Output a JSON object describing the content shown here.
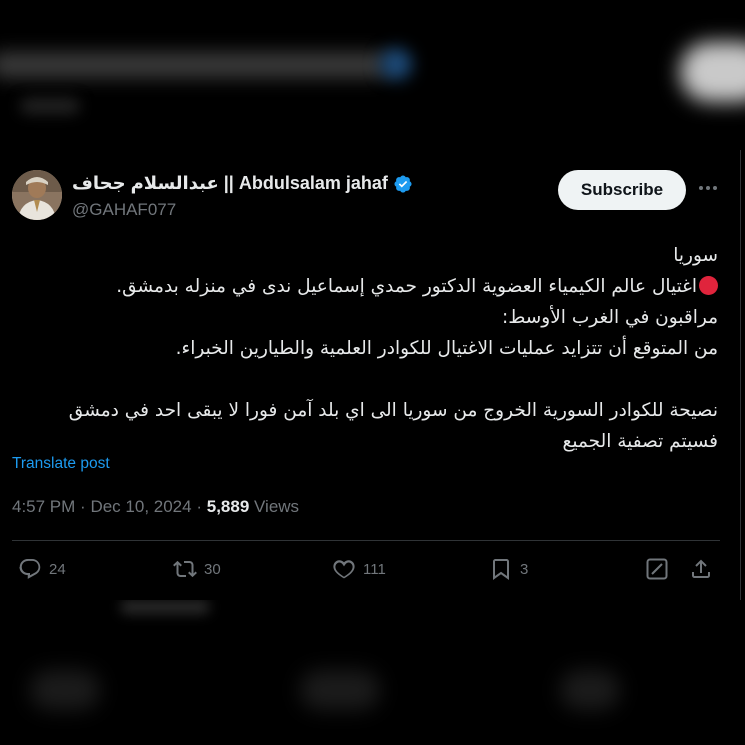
{
  "author": {
    "display_name": "عبدالسلام جحاف || Abdulsalam jahaf",
    "handle": "@GAHAF077",
    "verified": true
  },
  "subscribe_label": "Subscribe",
  "post": {
    "lines": [
      "سوريا",
      "اغتيال عالم الكيمياء العضوية الدكتور حمدي إسماعيل ندى في منزله بدمشق.",
      "مراقبون في الغرب الأوسط:",
      "من المتوقع أن تتزايد عمليات الاغتيال للكوادر العلمية والطيارين الخبراء.",
      "",
      "نصيحة للكوادر السورية الخروج من سوريا الى اي بلد آمن فورا لا يبقى احد في دمشق",
      "فسيتم تصفية الجميع"
    ]
  },
  "translate_label": "Translate post",
  "meta": {
    "time": "4:57 PM",
    "sep": "·",
    "date": "Dec 10, 2024",
    "views_count": "5,889",
    "views_label": "Views"
  },
  "actions": {
    "replies": "24",
    "reposts": "30",
    "likes": "111",
    "bookmarks": "3"
  },
  "colors": {
    "background": "#000000",
    "text": "#e7e9ea",
    "secondary": "#71767b",
    "link": "#1d9bf0",
    "verified": "#1d9bf0",
    "red_circle": "#e0243c",
    "subscribe_bg": "#eff3f4"
  },
  "icons": [
    "verified-badge-icon",
    "more-icon",
    "red-circle-emoji-icon",
    "reply-icon",
    "repost-icon",
    "like-icon",
    "bookmark-icon",
    "grok-icon",
    "share-icon"
  ]
}
